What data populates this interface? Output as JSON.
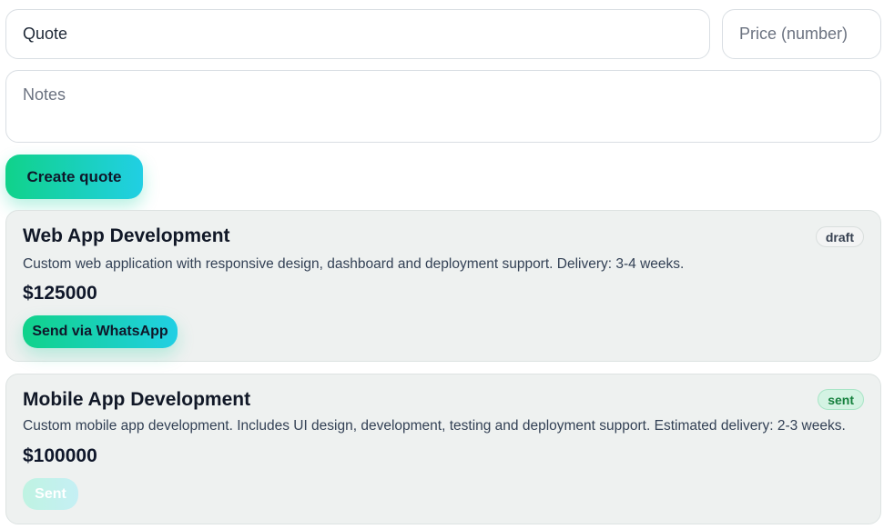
{
  "form": {
    "quote_value": "Quote",
    "price_placeholder": "Price (number)",
    "notes_placeholder": "Notes",
    "create_label": "Create quote"
  },
  "quotes": [
    {
      "title": "Web App Development",
      "status": "draft",
      "description": "Custom web application with responsive design, dashboard and deployment support. Delivery: 3-4 weeks.",
      "price": "$125000",
      "action_label": "Send via WhatsApp"
    },
    {
      "title": "Mobile App Development",
      "status": "sent",
      "description": "Custom mobile app development. Includes UI design, development, testing and deployment support. Estimated delivery: 2-3 weeks.",
      "price": "$100000",
      "action_label": "Sent"
    }
  ],
  "colors": {
    "accent_start": "#10d28a",
    "accent_end": "#21cfe4",
    "sent_badge_text": "#15803d",
    "card_bg": "#eef1f0"
  }
}
